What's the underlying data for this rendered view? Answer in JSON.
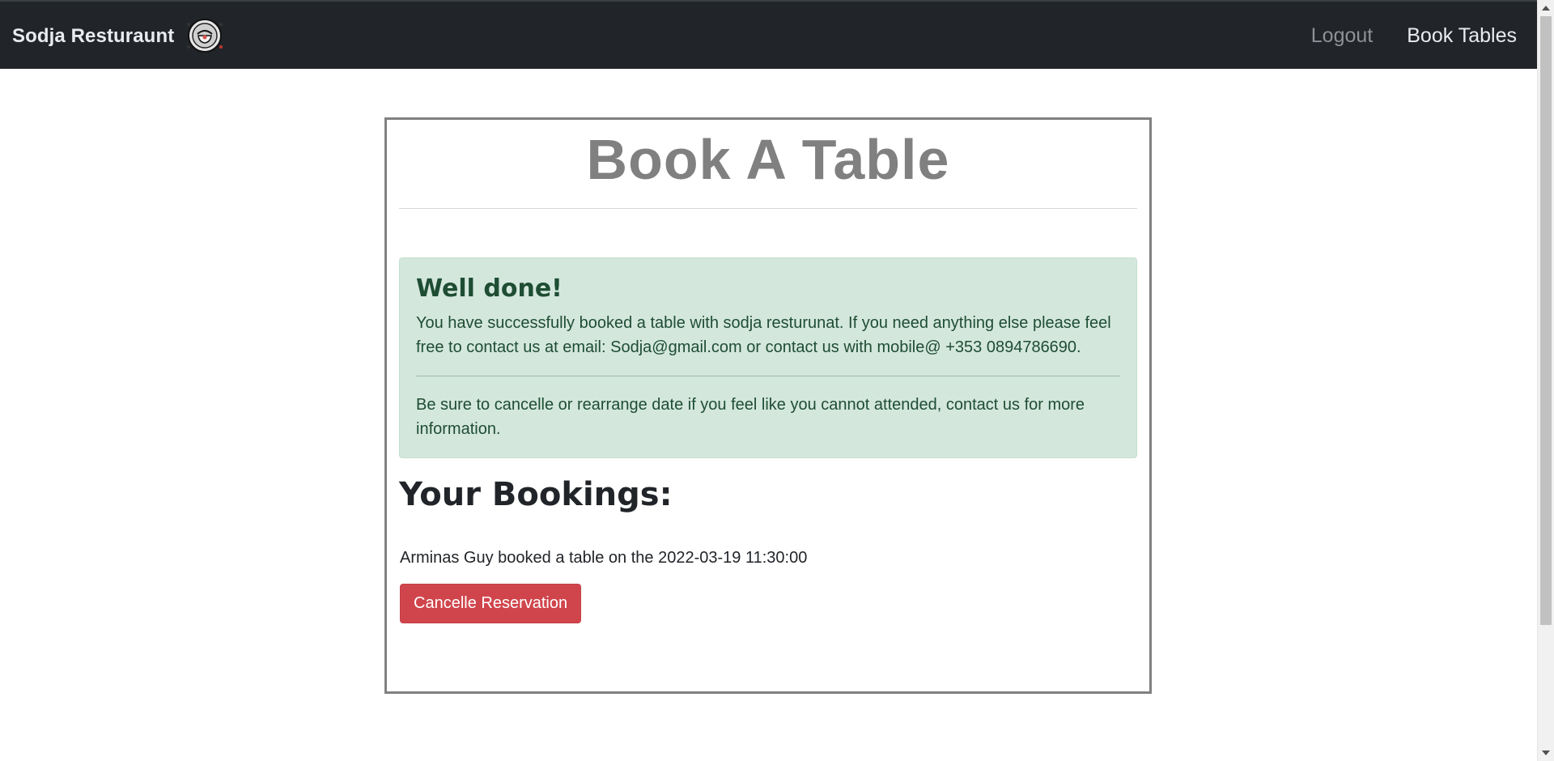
{
  "navbar": {
    "brand": "Sodja Resturaunt",
    "links": [
      {
        "label": "Logout"
      },
      {
        "label": "Book Tables"
      }
    ]
  },
  "main": {
    "title": "Book A Table",
    "alert": {
      "heading": "Well done!",
      "message": "You have successfully booked a table with sodja resturunat. If you need anything else please feel free to contact us at email: Sodja@gmail.com or contact us with mobile@ +353 0894786690.",
      "note": "Be sure to cancelle or rearrange date if you feel like you cannot attended, contact us for more information."
    },
    "bookings": {
      "heading": "Your Bookings:",
      "items": [
        {
          "text": "Arminas Guy booked a table on the 2022-03-19 11:30:00",
          "cancel_label": "Cancelle Reservation"
        }
      ]
    }
  },
  "colors": {
    "navbar_bg": "#212529",
    "alert_bg": "#d4e7dd",
    "cancel_button": "#d0454c",
    "title": "#808080"
  }
}
